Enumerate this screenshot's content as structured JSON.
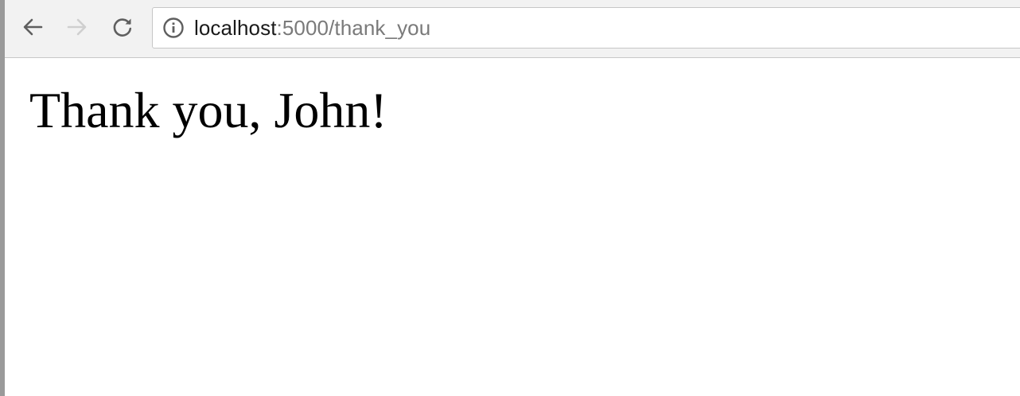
{
  "browser": {
    "back_icon": "arrow-left-icon",
    "forward_icon": "arrow-right-icon",
    "reload_icon": "reload-icon",
    "info_icon": "info-circle-icon",
    "address": {
      "host": "localhost",
      "path": ":5000/thank_you"
    },
    "colors": {
      "toolbar_bg": "#f2f2f2",
      "icon_active": "#5f5f5f",
      "icon_disabled": "#cfcfcf",
      "url_host": "#1a1a1a",
      "url_path": "#7a7a7a"
    }
  },
  "page": {
    "heading": "Thank you, John!"
  }
}
